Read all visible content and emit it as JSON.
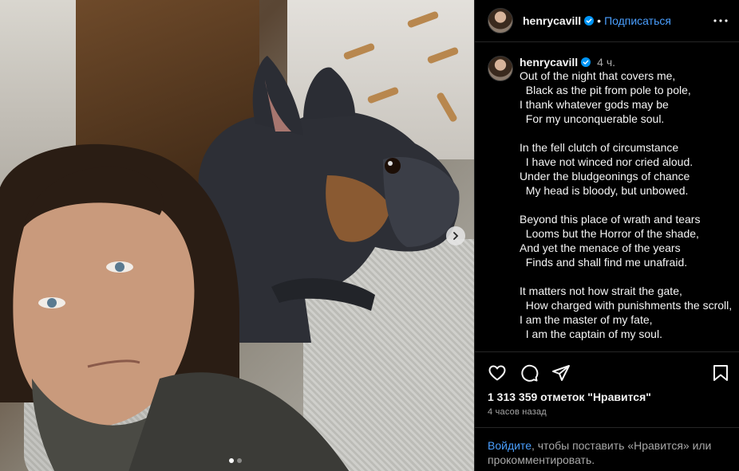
{
  "post": {
    "username": "henrycavill",
    "follow_label": "Подписаться",
    "separator": "•",
    "time_ago": "4 ч.",
    "caption_lines": [
      "Out of the night that covers me,",
      "  Black as the pit from pole to pole,",
      "I thank whatever gods may be",
      "  For my unconquerable soul.",
      "",
      "In the fell clutch of circumstance",
      "  I have not winced nor cried aloud.",
      "Under the bludgeonings of chance",
      "  My head is bloody, but unbowed.",
      "",
      "Beyond this place of wrath and tears",
      "  Looms but the Horror of the shade,",
      "And yet the menace of the years",
      "  Finds and shall find me unafraid.",
      "",
      "It matters not how strait the gate,",
      "  How charged with punishments the scroll,",
      "I am the master of my fate,",
      "  I am the captain of my soul."
    ],
    "likes_text": "1 313 359 отметок \"Нравится\"",
    "posted_text": "4 часов назад",
    "login_link": "Войдите",
    "login_rest": ", чтобы поставить «Нравится» или прокомментировать."
  },
  "carousel": {
    "total": 2,
    "current": 1
  },
  "icons": {
    "verified": "verified-badge-icon",
    "more": "more-options-icon",
    "like": "heart-icon",
    "comment": "comment-icon",
    "share": "share-icon",
    "save": "bookmark-icon",
    "next": "chevron-right-icon"
  },
  "colors": {
    "link": "#4a9fff",
    "verified": "#0095f6",
    "muted": "#a8a8a8"
  }
}
